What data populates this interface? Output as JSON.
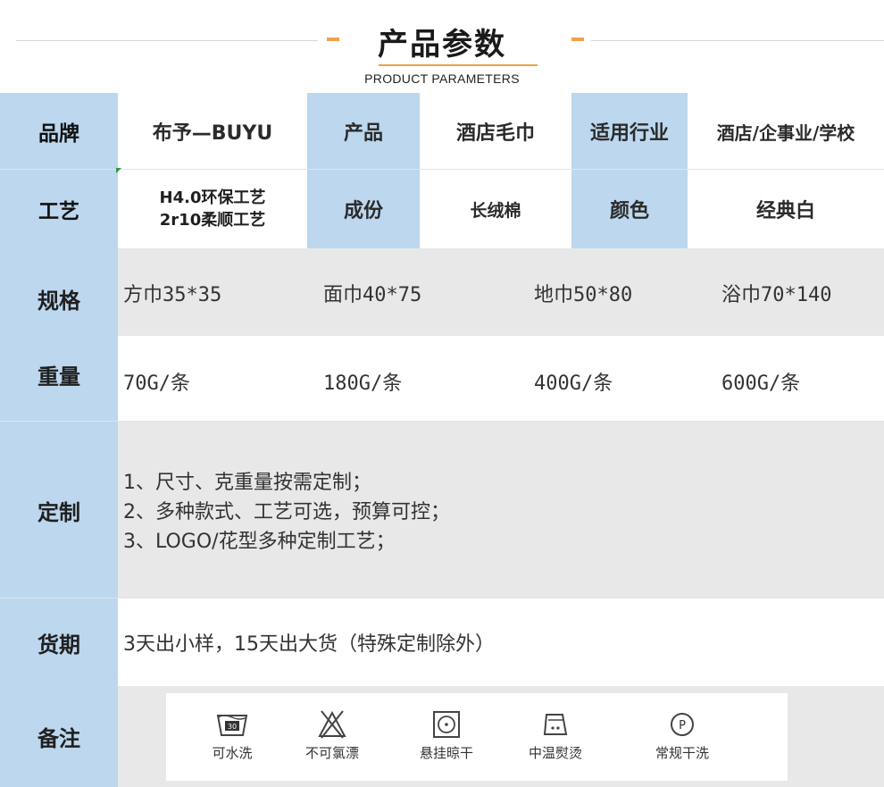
{
  "header": {
    "title": "产品参数",
    "subtitle": "PRODUCT PARAMETERS"
  },
  "rows": {
    "brand": {
      "label": "品牌",
      "value": "布予—BUYU",
      "product_label": "产品",
      "product_value": "酒店毛巾",
      "industry_label": "适用行业",
      "industry_value": "酒店/企事业/学校"
    },
    "craft": {
      "label": "工艺",
      "line1": "H4.0环保工艺",
      "line2": "2r10柔顺工艺",
      "material_label": "成份",
      "material_value": "长绒棉",
      "color_label": "颜色",
      "color_value": "经典白"
    },
    "spec": {
      "label": "规格",
      "values": [
        "方巾35*35",
        "面巾40*75",
        "地巾50*80",
        "浴巾70*140"
      ]
    },
    "weight": {
      "label": "重量",
      "values": [
        "70G/条",
        "180G/条",
        "400G/条",
        "600G/条"
      ]
    },
    "custom": {
      "label": "定制",
      "lines": [
        "1、尺寸、克重量按需定制；",
        "2、多种款式、工艺可选，预算可控；",
        "3、LOGO/花型多种定制工艺；"
      ]
    },
    "delivery": {
      "label": "货期",
      "value": "3天出小样，15天出大货（特殊定制除外）"
    },
    "notes": {
      "label": "备注",
      "care": [
        {
          "icon": "wash-30-icon",
          "label": "可水洗",
          "tag": "30"
        },
        {
          "icon": "no-bleach-icon",
          "label": "不可氯漂"
        },
        {
          "icon": "hang-dry-icon",
          "label": "悬挂晾干"
        },
        {
          "icon": "iron-medium-icon",
          "label": "中温熨烫"
        },
        {
          "icon": "dry-clean-icon",
          "label": "常规干洗",
          "tag": "P"
        }
      ]
    }
  },
  "colors": {
    "label_blue": "#bcd7ee",
    "row_grey": "#e8e8e8",
    "accent_orange": "#f1a04c"
  }
}
